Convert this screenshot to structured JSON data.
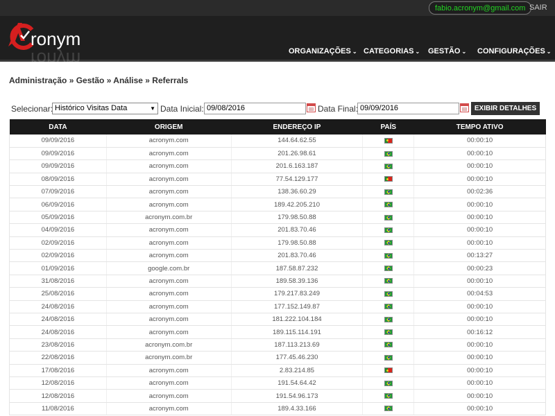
{
  "topbar": {
    "email": "fabio.acronym@gmail.com",
    "logout": "SAIR"
  },
  "logo": {
    "text": "ronym"
  },
  "nav": [
    {
      "label": "ORGANIZAÇÕES"
    },
    {
      "label": "CATEGORIAS"
    },
    {
      "label": "GESTÃO"
    },
    {
      "label": "CONFIGURAÇÕES"
    }
  ],
  "breadcrumb": "Administração » Gestão » Análise » Referrals",
  "filters": {
    "select_label": "Selecionar:",
    "select_value": "Histórico Visitas Data",
    "start_label": "Data Inicial:",
    "start_value": "09/08/2016",
    "end_label": "Data Final:",
    "end_value": "09/09/2016",
    "button": "EXIBIR DETALHES"
  },
  "table": {
    "headers": [
      "DATA",
      "ORIGEM",
      "ENDEREÇO IP",
      "PAÍS",
      "TEMPO ATIVO"
    ],
    "rows": [
      {
        "date": "09/09/2016",
        "origin": "acronym.com",
        "ip": "144.64.62.55",
        "country": "PT",
        "time": "00:00:10"
      },
      {
        "date": "09/09/2016",
        "origin": "acronym.com",
        "ip": "201.26.98.61",
        "country": "BR",
        "time": "00:00:10"
      },
      {
        "date": "09/09/2016",
        "origin": "acronym.com",
        "ip": "201.6.163.187",
        "country": "BR",
        "time": "00:00:10"
      },
      {
        "date": "08/09/2016",
        "origin": "acronym.com",
        "ip": "77.54.129.177",
        "country": "PT",
        "time": "00:00:10"
      },
      {
        "date": "07/09/2016",
        "origin": "acronym.com",
        "ip": "138.36.60.29",
        "country": "BR",
        "time": "00:02:36"
      },
      {
        "date": "06/09/2016",
        "origin": "acronym.com",
        "ip": "189.42.205.210",
        "country": "BR",
        "time": "00:00:10"
      },
      {
        "date": "05/09/2016",
        "origin": "acronym.com.br",
        "ip": "179.98.50.88",
        "country": "BR",
        "time": "00:00:10"
      },
      {
        "date": "04/09/2016",
        "origin": "acronym.com",
        "ip": "201.83.70.46",
        "country": "BR",
        "time": "00:00:10"
      },
      {
        "date": "02/09/2016",
        "origin": "acronym.com",
        "ip": "179.98.50.88",
        "country": "BR",
        "time": "00:00:10"
      },
      {
        "date": "02/09/2016",
        "origin": "acronym.com",
        "ip": "201.83.70.46",
        "country": "BR",
        "time": "00:13:27"
      },
      {
        "date": "01/09/2016",
        "origin": "google.com.br",
        "ip": "187.58.87.232",
        "country": "BR",
        "time": "00:00:23"
      },
      {
        "date": "31/08/2016",
        "origin": "acronym.com",
        "ip": "189.58.39.136",
        "country": "BR",
        "time": "00:00:10"
      },
      {
        "date": "25/08/2016",
        "origin": "acronym.com",
        "ip": "179.217.83.249",
        "country": "BR",
        "time": "00:04:53"
      },
      {
        "date": "24/08/2016",
        "origin": "acronym.com",
        "ip": "177.152.149.87",
        "country": "BR",
        "time": "00:00:10"
      },
      {
        "date": "24/08/2016",
        "origin": "acronym.com",
        "ip": "181.222.104.184",
        "country": "BR",
        "time": "00:00:10"
      },
      {
        "date": "24/08/2016",
        "origin": "acronym.com",
        "ip": "189.115.114.191",
        "country": "BR",
        "time": "00:16:12"
      },
      {
        "date": "23/08/2016",
        "origin": "acronym.com.br",
        "ip": "187.113.213.69",
        "country": "BR",
        "time": "00:00:10"
      },
      {
        "date": "22/08/2016",
        "origin": "acronym.com.br",
        "ip": "177.45.46.230",
        "country": "BR",
        "time": "00:00:10"
      },
      {
        "date": "17/08/2016",
        "origin": "acronym.com",
        "ip": "2.83.214.85",
        "country": "PT",
        "time": "00:00:10"
      },
      {
        "date": "12/08/2016",
        "origin": "acronym.com",
        "ip": "191.54.64.42",
        "country": "BR",
        "time": "00:00:10"
      },
      {
        "date": "12/08/2016",
        "origin": "acronym.com",
        "ip": "191.54.96.173",
        "country": "BR",
        "time": "00:00:10"
      },
      {
        "date": "11/08/2016",
        "origin": "acronym.com",
        "ip": "189.4.33.166",
        "country": "BR",
        "time": "00:00:10"
      }
    ]
  }
}
